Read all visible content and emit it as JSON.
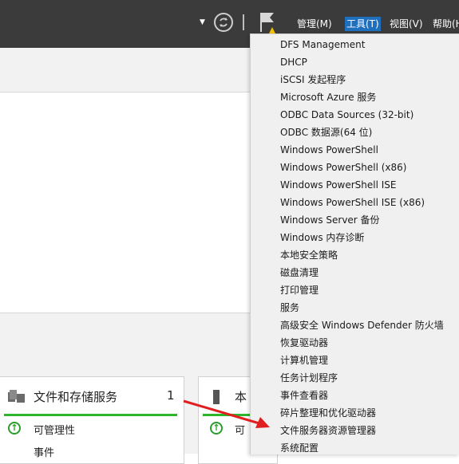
{
  "menubar": {
    "items": [
      "管理(M)",
      "工具(T)",
      "视图(V)",
      "帮助(H)"
    ],
    "active": "工具(T)"
  },
  "tools_menu": {
    "items": [
      "DFS Management",
      "DHCP",
      "iSCSI 发起程序",
      "Microsoft Azure 服务",
      "ODBC Data Sources (32-bit)",
      "ODBC 数据源(64 位)",
      "Windows PowerShell",
      "Windows PowerShell (x86)",
      "Windows PowerShell ISE",
      "Windows PowerShell ISE (x86)",
      "Windows Server 备份",
      "Windows 内存诊断",
      "本地安全策略",
      "磁盘清理",
      "打印管理",
      "服务",
      "高级安全 Windows Defender 防火墙",
      "恢复驱动器",
      "计算机管理",
      "任务计划程序",
      "事件查看器",
      "碎片整理和优化驱动器",
      "文件服务器资源管理器",
      "系统配置"
    ]
  },
  "tiles": {
    "file_storage": {
      "title": "文件和存储服务",
      "count": "1",
      "rows": [
        "可管理性",
        "事件"
      ]
    },
    "local": {
      "title": "本",
      "rows": [
        "可"
      ]
    }
  },
  "colors": {
    "titlebar": "#3b3b3b",
    "menu_active": "#1f6fbf",
    "status_green": "#2db52d",
    "annotation_arrow": "#e02020"
  }
}
